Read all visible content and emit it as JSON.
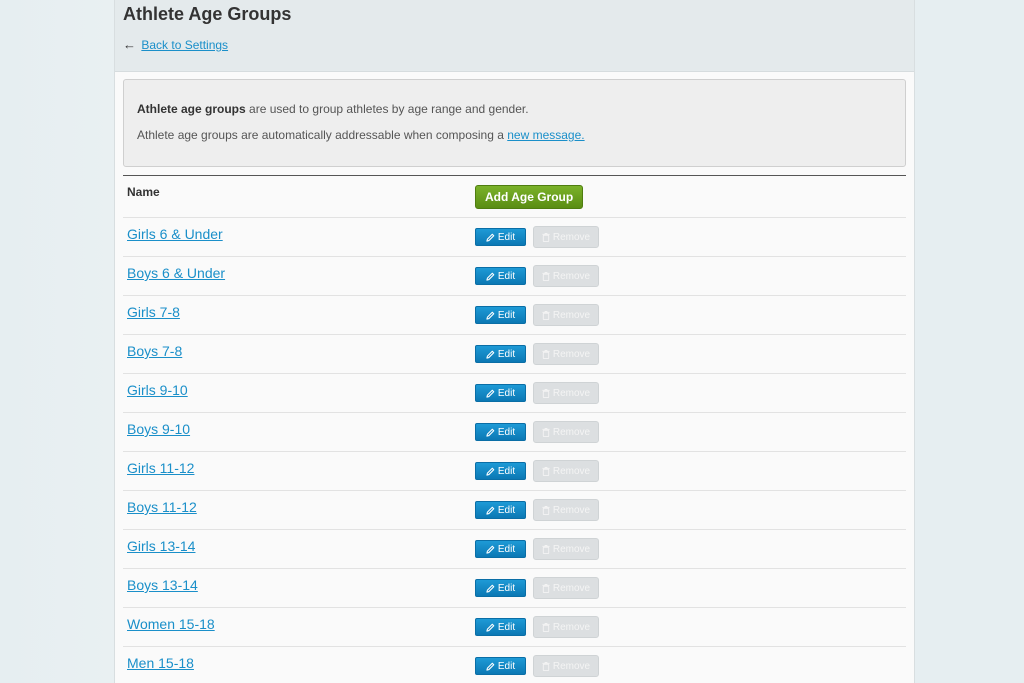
{
  "header": {
    "title": "Athlete Age Groups",
    "back_arrow": "←",
    "back_link": "Back to Settings"
  },
  "info": {
    "line1_bold": "Athlete age groups",
    "line1_rest": " are used to group athletes by age range and gender.",
    "line2_text": "Athlete age groups are automatically addressable when composing a ",
    "line2_link": "new message."
  },
  "table": {
    "name_header": "Name",
    "add_button_label": "Add Age Group",
    "edit_label": "Edit",
    "remove_label": "Remove",
    "rows": [
      {
        "name": "Girls 6 & Under"
      },
      {
        "name": "Boys 6 & Under"
      },
      {
        "name": "Girls 7-8"
      },
      {
        "name": "Boys 7-8"
      },
      {
        "name": "Girls 9-10"
      },
      {
        "name": "Boys 9-10"
      },
      {
        "name": "Girls 11-12"
      },
      {
        "name": "Boys 11-12"
      },
      {
        "name": "Girls 13-14"
      },
      {
        "name": "Boys 13-14"
      },
      {
        "name": "Women 15-18"
      },
      {
        "name": "Men 15-18"
      }
    ]
  },
  "colors": {
    "link": "#1a8fc9",
    "add_button": "#6aa01f",
    "edit_button": "#1488c6",
    "remove_button_disabled": "#dcdfe1"
  },
  "icons": {
    "edit": "pencil-icon",
    "remove": "trash-icon"
  }
}
